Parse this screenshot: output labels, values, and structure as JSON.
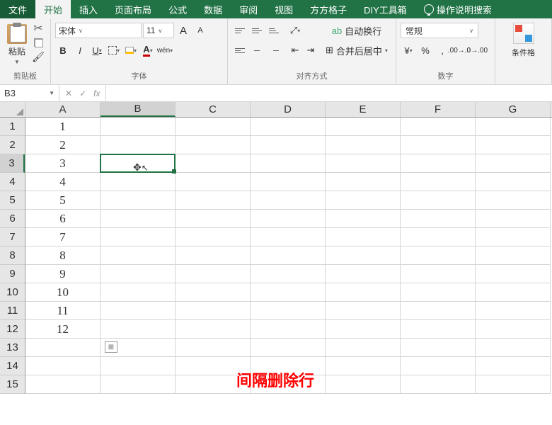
{
  "tabs": {
    "file": "文件",
    "home": "开始",
    "insert": "插入",
    "layout": "页面布局",
    "formula": "公式",
    "data": "数据",
    "review": "审阅",
    "view": "视图",
    "addon1": "方方格子",
    "addon2": "DIY工具箱",
    "search": "操作说明搜索"
  },
  "ribbon": {
    "clipboard": {
      "paste": "粘贴",
      "label": "剪贴板"
    },
    "font": {
      "name": "宋体",
      "size": "11",
      "label": "字体",
      "bold": "B",
      "italic": "I",
      "underline": "U",
      "wen": "wén",
      "increase": "A",
      "decrease": "A"
    },
    "align": {
      "wrap": "自动换行",
      "merge": "合并后居中",
      "label": "对齐方式"
    },
    "number": {
      "format": "常规",
      "label": "数字",
      "percent": "%",
      "comma": ","
    },
    "cond": {
      "label": "条件格"
    }
  },
  "nameBox": "B3",
  "cols": [
    "A",
    "B",
    "C",
    "D",
    "E",
    "F",
    "G"
  ],
  "rows": [
    "1",
    "2",
    "3",
    "4",
    "5",
    "6",
    "7",
    "8",
    "9",
    "10",
    "11",
    "12",
    "13",
    "14",
    "15"
  ],
  "colA": [
    "1",
    "2",
    "3",
    "4",
    "5",
    "6",
    "7",
    "8",
    "9",
    "10",
    "11",
    "12",
    "",
    "",
    ""
  ],
  "selected": {
    "row": 2,
    "col": 1
  },
  "overlay": "间隔删除行"
}
